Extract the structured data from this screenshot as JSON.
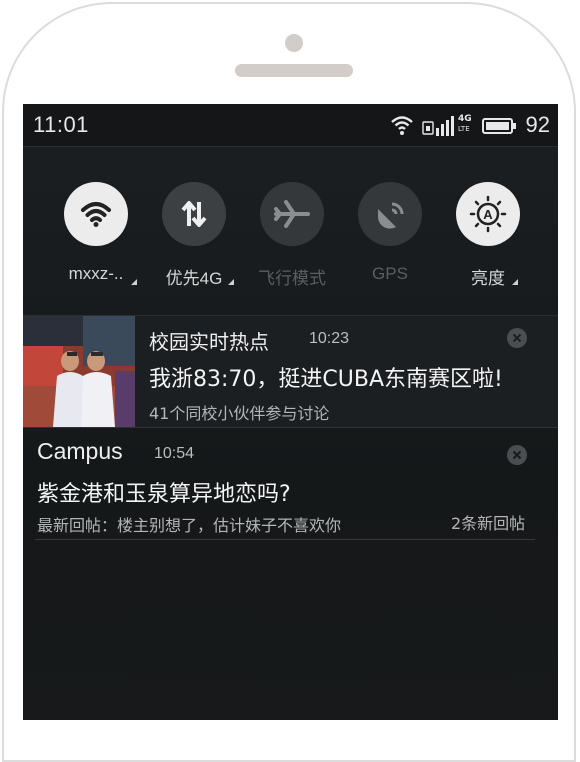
{
  "status_bar": {
    "time": "11:01",
    "network_type": "4G",
    "network_sub": "LTE",
    "battery": "92"
  },
  "quick_settings": [
    {
      "label": "mxxz-..",
      "state": "on",
      "icon": "wifi-icon"
    },
    {
      "label": "优先4G",
      "state": "on",
      "icon": "data-arrows-icon"
    },
    {
      "label": "飞行模式",
      "state": "off",
      "icon": "airplane-icon"
    },
    {
      "label": "GPS",
      "state": "off",
      "icon": "gps-icon"
    },
    {
      "label": "亮度",
      "state": "on",
      "icon": "brightness-auto-icon"
    }
  ],
  "notifications": [
    {
      "title": "校园实时热点",
      "time": "10:23",
      "body": "我浙83:70，挺进CUBA东南赛区啦!",
      "subtext": "41个同校小伙伴参与讨论"
    },
    {
      "title": "Campus",
      "time": "10:54",
      "body": "紫金港和玉泉算异地恋吗?",
      "subtext": "最新回帖：楼主别想了，估计妹子不喜欢你",
      "count": "2条新回帖"
    }
  ],
  "colors": {
    "panel_bg": "#161a1c",
    "toggle_on": "#ececec",
    "toggle_off": "#34383a"
  }
}
